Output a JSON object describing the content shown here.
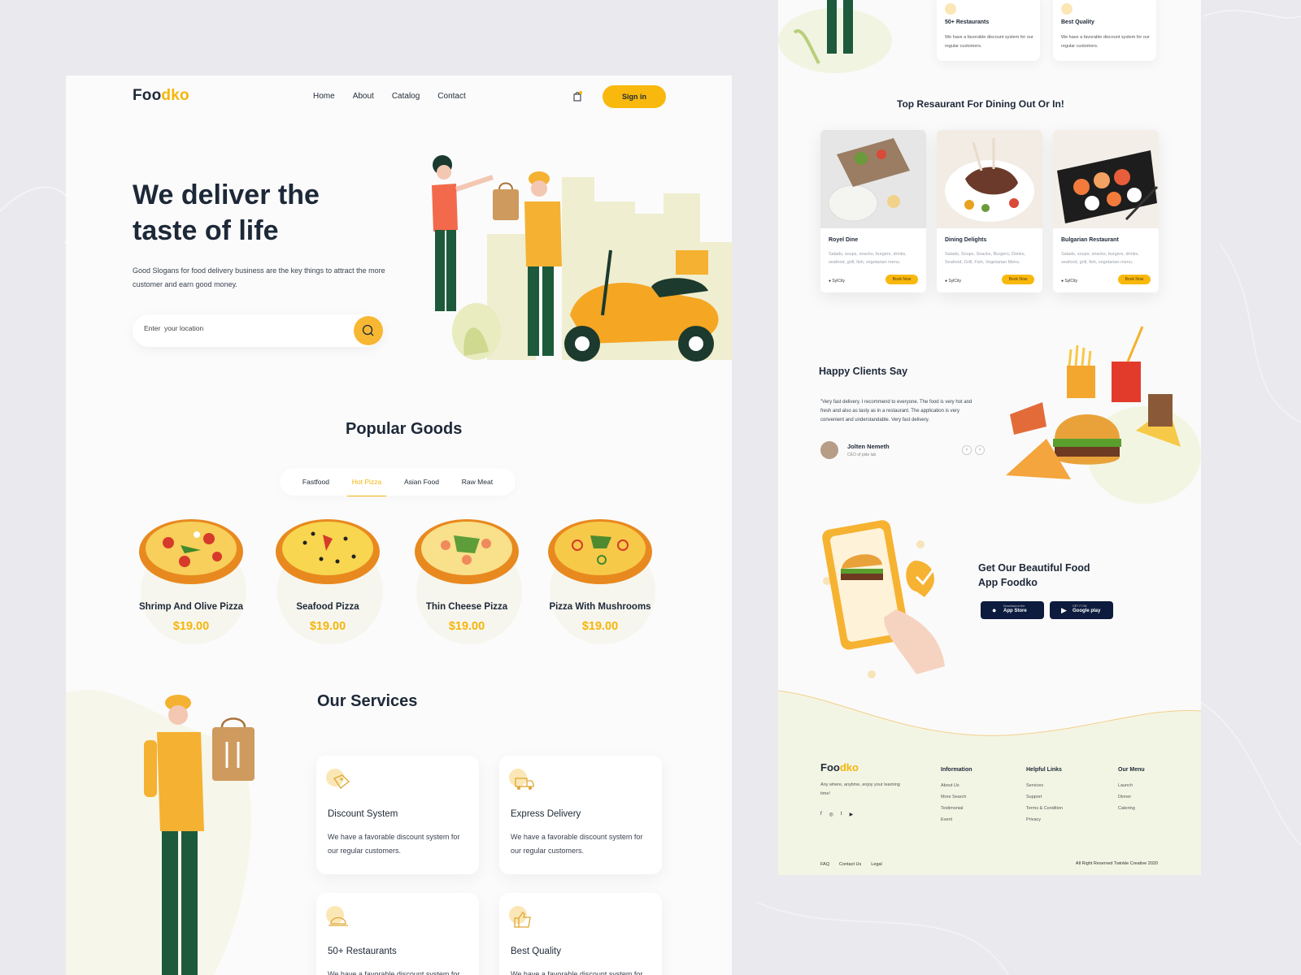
{
  "brand": {
    "name_part1": "Foo",
    "name_part2": "dko",
    "accent_color": "#f5b50a"
  },
  "nav": {
    "links": [
      "Home",
      "About",
      "Catalog",
      "Contact"
    ],
    "cart_icon": "shopping-bag-icon",
    "signin_label": "Sign in"
  },
  "hero": {
    "title": "We deliver the taste of life",
    "subtitle": "Good Slogans for food delivery business are the key things to attract the more customer and earn good money.",
    "search_placeholder": "Enter  your location",
    "search_icon": "search-icon"
  },
  "popular": {
    "title": "Popular Goods",
    "tabs": [
      "Fastfood",
      "Hot Pizza",
      "Asian Food",
      "Raw Meat"
    ],
    "active_tab": "Hot Pizza",
    "products": [
      {
        "name": "Shrimp And Olive Pizza",
        "price": "$19.00"
      },
      {
        "name": "Seafood Pizza",
        "price": "$19.00"
      },
      {
        "name": "Thin Cheese Pizza",
        "price": "$19.00"
      },
      {
        "name": "Pizza With Mushrooms",
        "price": "$19.00"
      }
    ]
  },
  "services": {
    "title": "Our Services",
    "items": [
      {
        "title": "Discount System",
        "desc": "We have a favorable discount system for our regular customers.",
        "icon": "discount-tag-icon"
      },
      {
        "title": "Express Delivery",
        "desc": "We have a favorable discount system for our regular customers.",
        "icon": "delivery-truck-icon"
      },
      {
        "title": "50+ Restaurants",
        "desc": "We have a favorable discount system for our regular customers.",
        "icon": "cloche-icon"
      },
      {
        "title": "Best Quality",
        "desc": "We have a favorable discount system for our regular customers.",
        "icon": "thumbs-up-icon"
      }
    ]
  },
  "right_services": [
    {
      "title": "50+ Restaurants",
      "desc": "We have a favorable discount system for our regular customers."
    },
    {
      "title": "Best Quality",
      "desc": "We have a favorable discount system for our regular customers."
    }
  ],
  "restaurants": {
    "title": "Top Resaurant  For Dining Out Or In!",
    "items": [
      {
        "name": "Royel Dine",
        "desc": "Salads, soups, snacks, burgers, drinks, seafood, grill, fish, vegetarian menu.",
        "location": "SylCity",
        "button": "Book Now"
      },
      {
        "name": "Dining Delights",
        "desc": "Salads, Soups, Snacks, Burgers, Drinks, Seafood, Grill, Fish, Vegetarian Menu.",
        "location": "SylCity",
        "button": "Book Now"
      },
      {
        "name": "Bulgarian Restaurant",
        "desc": "Salads, soups, snacks, burgers, drinks, seafood, grill, fish, vegetarian menu.",
        "location": "SylCity",
        "button": "Book Now"
      }
    ]
  },
  "testimonial": {
    "title": "Happy Clients Say",
    "quote": "\"Very fast delivery. I recommend to everyone. The food is very hot and fresh and also as tasty as in a restaurant. The application is very convenient and understandable. Very fast delivery.",
    "name": "Jolten Nemeth",
    "role": "CEO of pide lab",
    "prev": "‹",
    "next": "›"
  },
  "app": {
    "title": "Get Our Beautiful Food App Foodko",
    "appstore_small": "Download on the",
    "appstore_big": "App Store",
    "play_small": "GET IT ON",
    "play_big": "Google play"
  },
  "footer": {
    "about": "Any where, anytime, enjoy your learning time!",
    "socials": [
      "f",
      "◎",
      "t",
      "▶"
    ],
    "columns": [
      {
        "heading": "Information",
        "links": [
          "About Us",
          "More Search",
          "Testimonial",
          "Event"
        ]
      },
      {
        "heading": "Helpful Links",
        "links": [
          "Services",
          "Support",
          "Terms & Condition",
          "Privacy"
        ]
      },
      {
        "heading": "Our Menu",
        "links": [
          "Launch",
          "Dinner",
          "Catering"
        ]
      }
    ],
    "bottom_links": [
      "FAQ",
      "Contact Us",
      "Legal"
    ],
    "copyright": "All Right Reserved Twinkle Creative 2020"
  }
}
